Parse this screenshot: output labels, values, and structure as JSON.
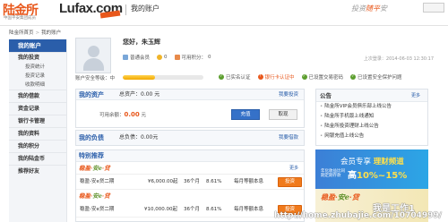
{
  "header": {
    "logo_cn": "陆金所",
    "logo_sub": "中国平安集团成员",
    "logo_en": "Lufax",
    "logo_dotcom": ".com",
    "title": "我的账户",
    "slogan_a": "投资",
    "slogan_b": "随平",
    "slogan_c": "安"
  },
  "breadcrumb": {
    "home": "陆金所首页",
    "current": "我的账户"
  },
  "sidebar": {
    "top": "我的账户",
    "invest": "我的投资",
    "invest_items": [
      "投资统计",
      "投资记录",
      "收款明细"
    ],
    "items": [
      "我的借款",
      "资金记录",
      "银行卡管理",
      "我的资料",
      "我的积分",
      "我的陆金币",
      "推荐好友"
    ]
  },
  "profile": {
    "greeting": "您好，朱玉辉",
    "member": "普通会员",
    "points_label": "可用积分：",
    "points_value": "0",
    "last_login": "上次登录：2014-06-03 12:30:17"
  },
  "safety": {
    "label": "账户安全等级：中",
    "level_pct": 40,
    "checks": [
      "已实名认证",
      "银行卡认证中",
      "已设置交易密码",
      "已设置安全保护问题"
    ]
  },
  "assets": {
    "title": "我的资产",
    "sum_label": "总资产：",
    "sum_value": "0.00 元",
    "link": "我要投资",
    "balance_label": "可用余额：",
    "balance_value": "0.00",
    "balance_unit": "元",
    "recharge": "充值",
    "withdraw": "取现"
  },
  "debts": {
    "title": "我的负债",
    "sum_label": "总负债：",
    "sum_value": "0.00元",
    "link": "我要借款"
  },
  "recommend": {
    "title": "特别推荐",
    "brand_a": "稳盈",
    "brand_b": "安e",
    "brand_c": "贷",
    "more": "更多",
    "rows": [
      {
        "name": "稳盈-安e贷二期",
        "amount": "¥6,000.00起",
        "term": "36个月",
        "rate": "8.61%",
        "type": "每月等额本息",
        "action": "投资"
      },
      {
        "name": "稳盈-安e贷二期",
        "amount": "¥10,000.00起",
        "term": "36个月",
        "rate": "8.61%",
        "type": "每月等额本息",
        "action": "投资"
      }
    ]
  },
  "notice": {
    "title": "公告",
    "more": "更多",
    "items": [
      "陆金所VIP会员俱乐部上线公告",
      "陆金所手机版上线通知",
      "陆金所投资理财上线公告",
      "网银充值上线公告"
    ]
  },
  "banner1": {
    "l1a": "会员专享",
    "l1b": "理财频道",
    "l2": "年化收益比同期定期存款",
    "l3a": "高",
    "l3b": "10%~15%"
  },
  "banner2": {
    "a": "稳盈",
    "b": "安e",
    "c": "贷"
  },
  "watermark": {
    "w1": "我是工作1",
    "w2": "http://home.zhubajie.com/10704999/"
  },
  "colors": {
    "brand_orange": "#e8581c",
    "brand_blue": "#2a5eaa",
    "accent_green": "#5c8f27"
  }
}
